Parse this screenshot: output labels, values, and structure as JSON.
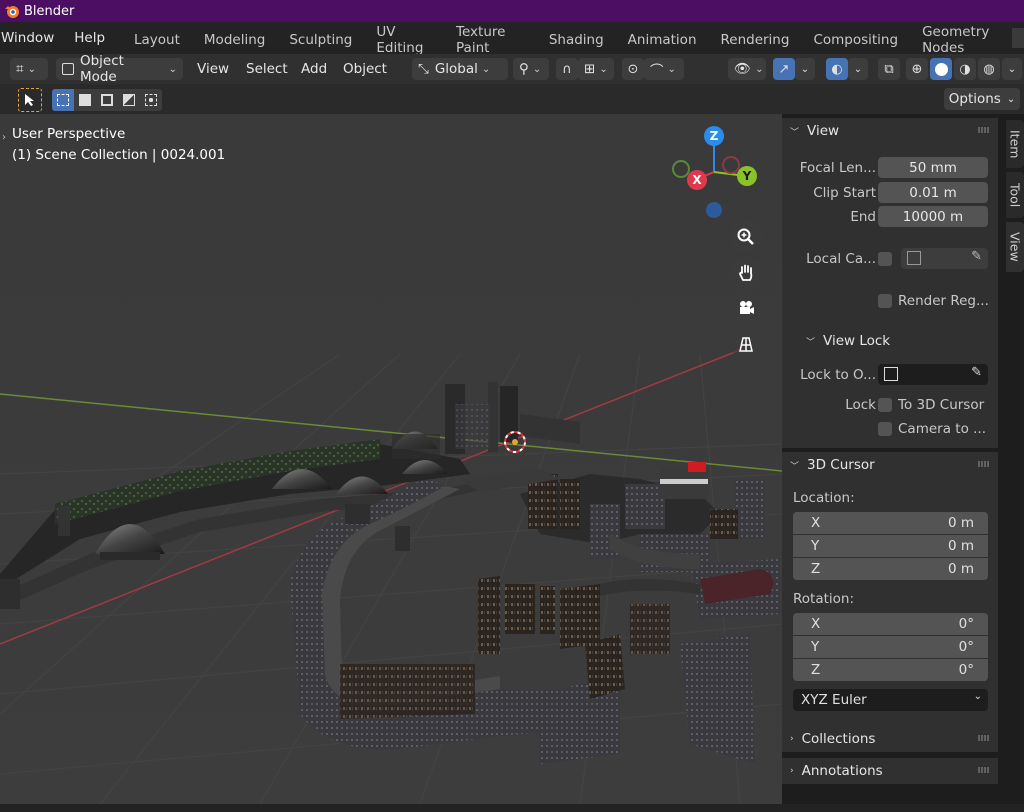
{
  "app": {
    "title": "Blender"
  },
  "menu": {
    "items": [
      "Window",
      "Help"
    ]
  },
  "workspaces": [
    "Layout",
    "Modeling",
    "Sculpting",
    "UV Editing",
    "Texture Paint",
    "Shading",
    "Animation",
    "Rendering",
    "Compositing",
    "Geometry Nodes"
  ],
  "header": {
    "mode": "Object Mode",
    "menus": [
      "View",
      "Select",
      "Add",
      "Object"
    ],
    "transform_orientation": "Global"
  },
  "toolrow": {
    "options_label": "Options"
  },
  "viewport": {
    "perspective_label": "User Perspective",
    "collection_label": "(1) Scene Collection | 0024.001",
    "gizmo_axes": {
      "x": "X",
      "y": "Y",
      "z": "Z"
    }
  },
  "panel": {
    "view": {
      "title": "View",
      "focal_label": "Focal Len...",
      "focal_value": "50 mm",
      "clip_start_label": "Clip Start",
      "clip_start_value": "0.01 m",
      "clip_end_label": "End",
      "clip_end_value": "10000 m",
      "local_camera_label": "Local Ca...",
      "render_region_label": "Render Reg..."
    },
    "view_lock": {
      "title": "View Lock",
      "lock_to_object_label": "Lock to O...",
      "lock_label": "Lock",
      "to_3d_cursor_label": "To 3D Cursor",
      "camera_to_label": "Camera to ..."
    },
    "cursor": {
      "title": "3D Cursor",
      "location_label": "Location:",
      "location": [
        {
          "axis": "X",
          "value": "0 m"
        },
        {
          "axis": "Y",
          "value": "0 m"
        },
        {
          "axis": "Z",
          "value": "0 m"
        }
      ],
      "rotation_label": "Rotation:",
      "rotation": [
        {
          "axis": "X",
          "value": "0°"
        },
        {
          "axis": "Y",
          "value": "0°"
        },
        {
          "axis": "Z",
          "value": "0°"
        }
      ],
      "rotation_mode": "XYZ Euler"
    },
    "collections_title": "Collections",
    "annotations_title": "Annotations"
  },
  "sidetabs": [
    "Item",
    "Tool",
    "View"
  ],
  "colors": {
    "title_bar": "#4b0e63",
    "accent_blue": "#4772b3",
    "x_axis": "#e0394e",
    "y_axis": "#8cc229",
    "z_axis": "#2c8ceb",
    "cursor": "#e5a33a"
  }
}
